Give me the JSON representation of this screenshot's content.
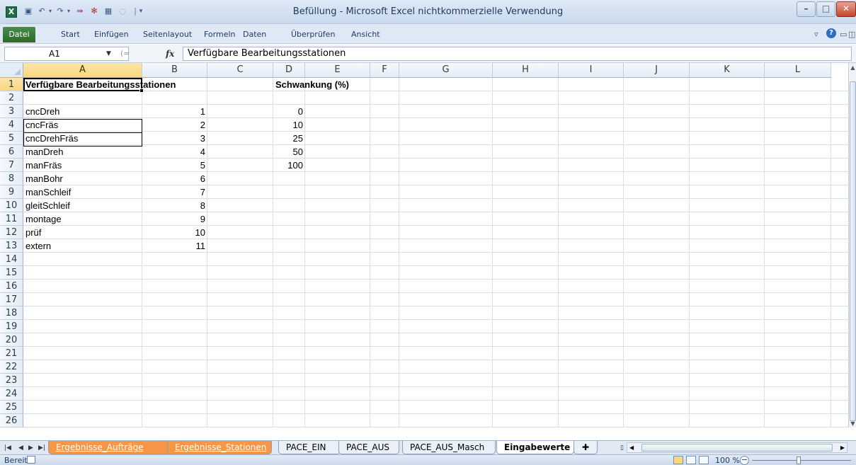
{
  "window": {
    "title": "Befüllung - Microsoft Excel nichtkommerzielle Verwendung",
    "min_label": "–",
    "max_label": "□",
    "close_label": "✕"
  },
  "quick_access": [
    "save-icon",
    "undo-icon",
    "redo-icon",
    "custom-icon-1",
    "custom-icon-2",
    "custom-icon-3",
    "custom-icon-4",
    "customize-dropdown-icon"
  ],
  "ribbon": {
    "tabs": [
      "Datei",
      "Start",
      "Einfügen",
      "Seitenlayout",
      "Formeln",
      "Daten",
      "Überprüfen",
      "Ansicht"
    ]
  },
  "formula_bar": {
    "name_box": "A1",
    "fx": "fx",
    "content": "Verfügbare Bearbeitungsstationen"
  },
  "grid": {
    "columns": [
      "A",
      "B",
      "C",
      "D",
      "E",
      "F",
      "G",
      "H",
      "I",
      "J",
      "K",
      "L"
    ],
    "selected_column": "A",
    "rows": [
      "1",
      "2",
      "3",
      "4",
      "5",
      "6",
      "7",
      "8",
      "9",
      "10",
      "11",
      "12",
      "13",
      "14",
      "15",
      "16",
      "17",
      "18",
      "19",
      "20",
      "21",
      "22",
      "23",
      "24",
      "25",
      "26"
    ],
    "selected_row": "1",
    "cells": {
      "A1": "Verfügbare Bearbeitungsstationen",
      "D1": "Schwankung (%)",
      "A3": "cncDreh",
      "B3": "1",
      "D3": "0",
      "A4": "cncFräs",
      "B4": "2",
      "D4": "10",
      "A5": "cncDrehFräs",
      "B5": "3",
      "D5": "25",
      "A6": "manDreh",
      "B6": "4",
      "D6": "50",
      "A7": "manFräs",
      "B7": "5",
      "D7": "100",
      "A8": "manBohr",
      "B8": "6",
      "A9": "manSchleif",
      "B9": "7",
      "A10": "gleitSchleif",
      "B10": "8",
      "A11": "montage",
      "B11": "9",
      "A12": "prüf",
      "B12": "10",
      "A13": "extern",
      "B13": "11"
    }
  },
  "sheet_tabs": [
    {
      "label": "Ergebnisse_Aufträge",
      "style": "orange"
    },
    {
      "label": "Ergebnisse_Stationen",
      "style": "orange"
    },
    {
      "label": "PACE_EIN",
      "style": "normal"
    },
    {
      "label": "PACE_AUS",
      "style": "normal"
    },
    {
      "label": "PACE_AUS_Masch",
      "style": "normal"
    },
    {
      "label": "Eingabewerte",
      "style": "active"
    }
  ],
  "status": {
    "ready": "Bereit",
    "zoom": "100 %",
    "zoom_minus": "−"
  },
  "colors": {
    "tab_orange": "#f79646",
    "selected_header": "#f9d780",
    "datei_green": "#2a6b2a"
  }
}
